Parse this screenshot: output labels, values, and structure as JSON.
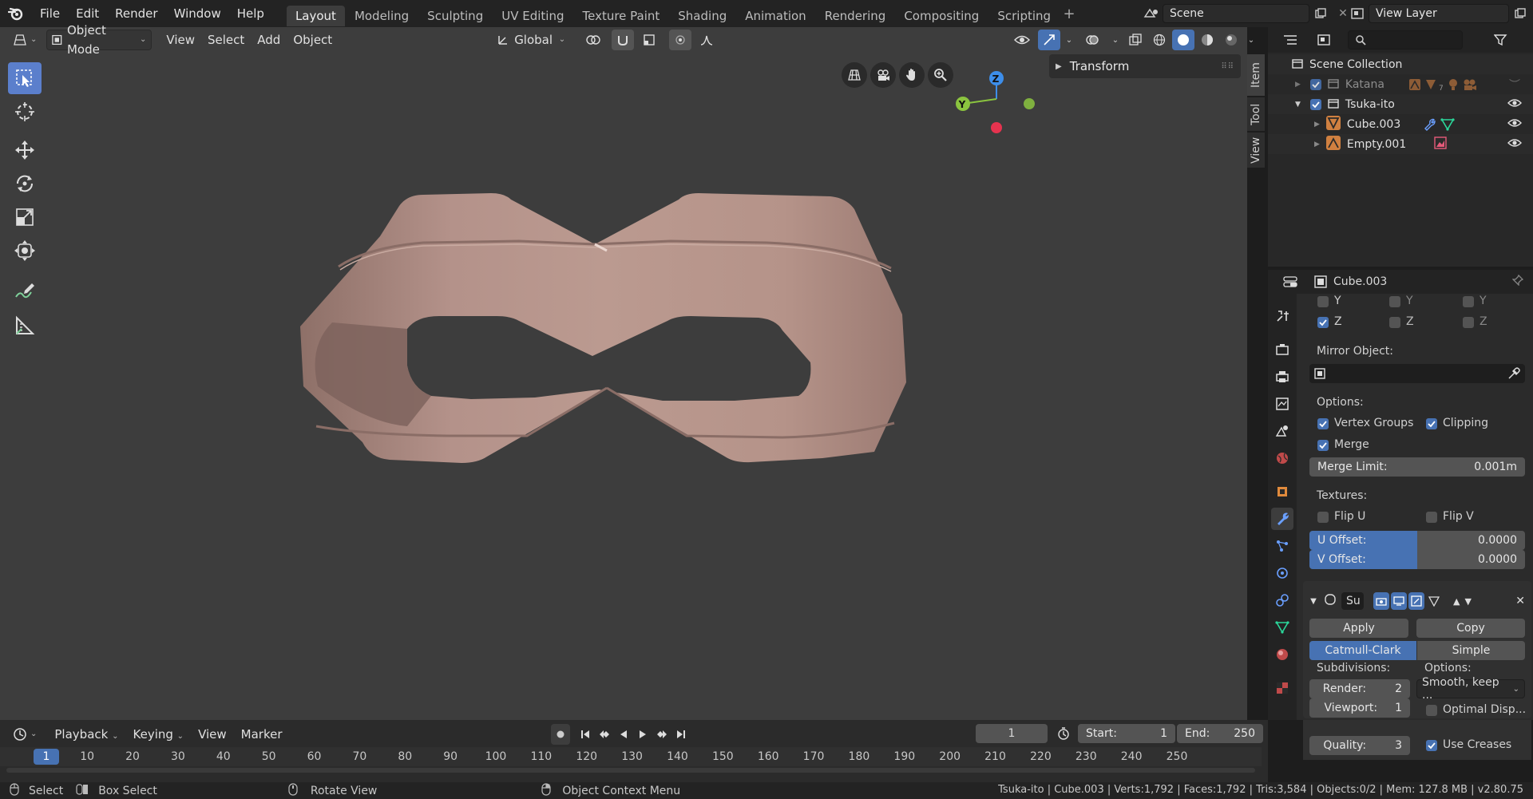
{
  "topbar": {
    "menus": [
      "File",
      "Edit",
      "Render",
      "Window",
      "Help"
    ],
    "workspaces": [
      "Layout",
      "Modeling",
      "Sculpting",
      "UV Editing",
      "Texture Paint",
      "Shading",
      "Animation",
      "Rendering",
      "Compositing",
      "Scripting"
    ],
    "active_workspace": "Layout",
    "scene": "Scene",
    "view_layer": "View Layer"
  },
  "viewport_header": {
    "mode": "Object Mode",
    "menus": [
      "View",
      "Select",
      "Add",
      "Object"
    ],
    "orientation": "Global"
  },
  "viewport": {
    "sidebar_panel": "Transform",
    "side_tabs": [
      "Item",
      "Tool",
      "View"
    ],
    "gizmo": {
      "z": "Z",
      "y": "Y"
    }
  },
  "outliner": {
    "root": "Scene Collection",
    "items": [
      {
        "name": "Katana",
        "level": 1,
        "enabled": true,
        "dimmed": true
      },
      {
        "name": "Tsuka-ito",
        "level": 1,
        "enabled": true,
        "dimmed": false
      },
      {
        "name": "Cube.003",
        "level": 2,
        "dimmed": false
      },
      {
        "name": "Empty.001",
        "level": 2,
        "dimmed": false
      }
    ],
    "badge_count": "7"
  },
  "properties": {
    "object_name": "Cube.003",
    "axis_rows": [
      {
        "label": "Y",
        "checks": [
          false,
          false,
          false
        ]
      },
      {
        "label": "Z",
        "checks": [
          true,
          false,
          false
        ]
      }
    ],
    "mirror_object_label": "Mirror Object:",
    "options_label": "Options:",
    "vertex_groups": "Vertex Groups",
    "clipping": "Clipping",
    "merge": "Merge",
    "merge_limit_label": "Merge Limit:",
    "merge_limit_value": "0.001m",
    "textures_label": "Textures:",
    "flip_u": "Flip U",
    "flip_v": "Flip V",
    "u_offset_label": "U Offset:",
    "u_offset_value": "0.0000",
    "v_offset_label": "V Offset:",
    "v_offset_value": "0.0000",
    "subsurf_name": "Su",
    "apply": "Apply",
    "copy": "Copy",
    "catmull": "Catmull-Clark",
    "simple": "Simple",
    "subdivisions_label": "Subdivisions:",
    "options2_label": "Options:",
    "render_label": "Render:",
    "render_value": "2",
    "viewport_label": "Viewport:",
    "viewport_value": "1",
    "quality_label": "Quality:",
    "quality_value": "3",
    "smooth_option": "Smooth, keep ...",
    "optimal_display": "Optimal Disp...",
    "use_creases": "Use Creases"
  },
  "timeline": {
    "menus": [
      "Playback",
      "Keying",
      "View",
      "Marker"
    ],
    "current_frame": "1",
    "start_label": "Start:",
    "start_value": "1",
    "end_label": "End:",
    "end_value": "250",
    "ruler_marks": [
      "1",
      "10",
      "20",
      "30",
      "40",
      "50",
      "60",
      "70",
      "80",
      "90",
      "100",
      "110",
      "120",
      "130",
      "140",
      "150",
      "160",
      "170",
      "180",
      "190",
      "200",
      "210",
      "220",
      "230",
      "240",
      "250"
    ]
  },
  "statusbar": {
    "select": "Select",
    "box_select": "Box Select",
    "rotate_view": "Rotate View",
    "context_menu": "Object Context Menu",
    "stats": "Tsuka-ito | Cube.003 | Verts:1,792 | Faces:1,792 | Tris:3,584 | Objects:0/2 | Mem: 127.8 MB | v2.80.75"
  },
  "colors": {
    "accent": "#4772b3",
    "tool_active": "#5b7fcc",
    "mesh": "#b7958a",
    "axis_x": "#e5334f",
    "axis_y": "#8bc43f",
    "axis_z": "#3d8eea"
  }
}
